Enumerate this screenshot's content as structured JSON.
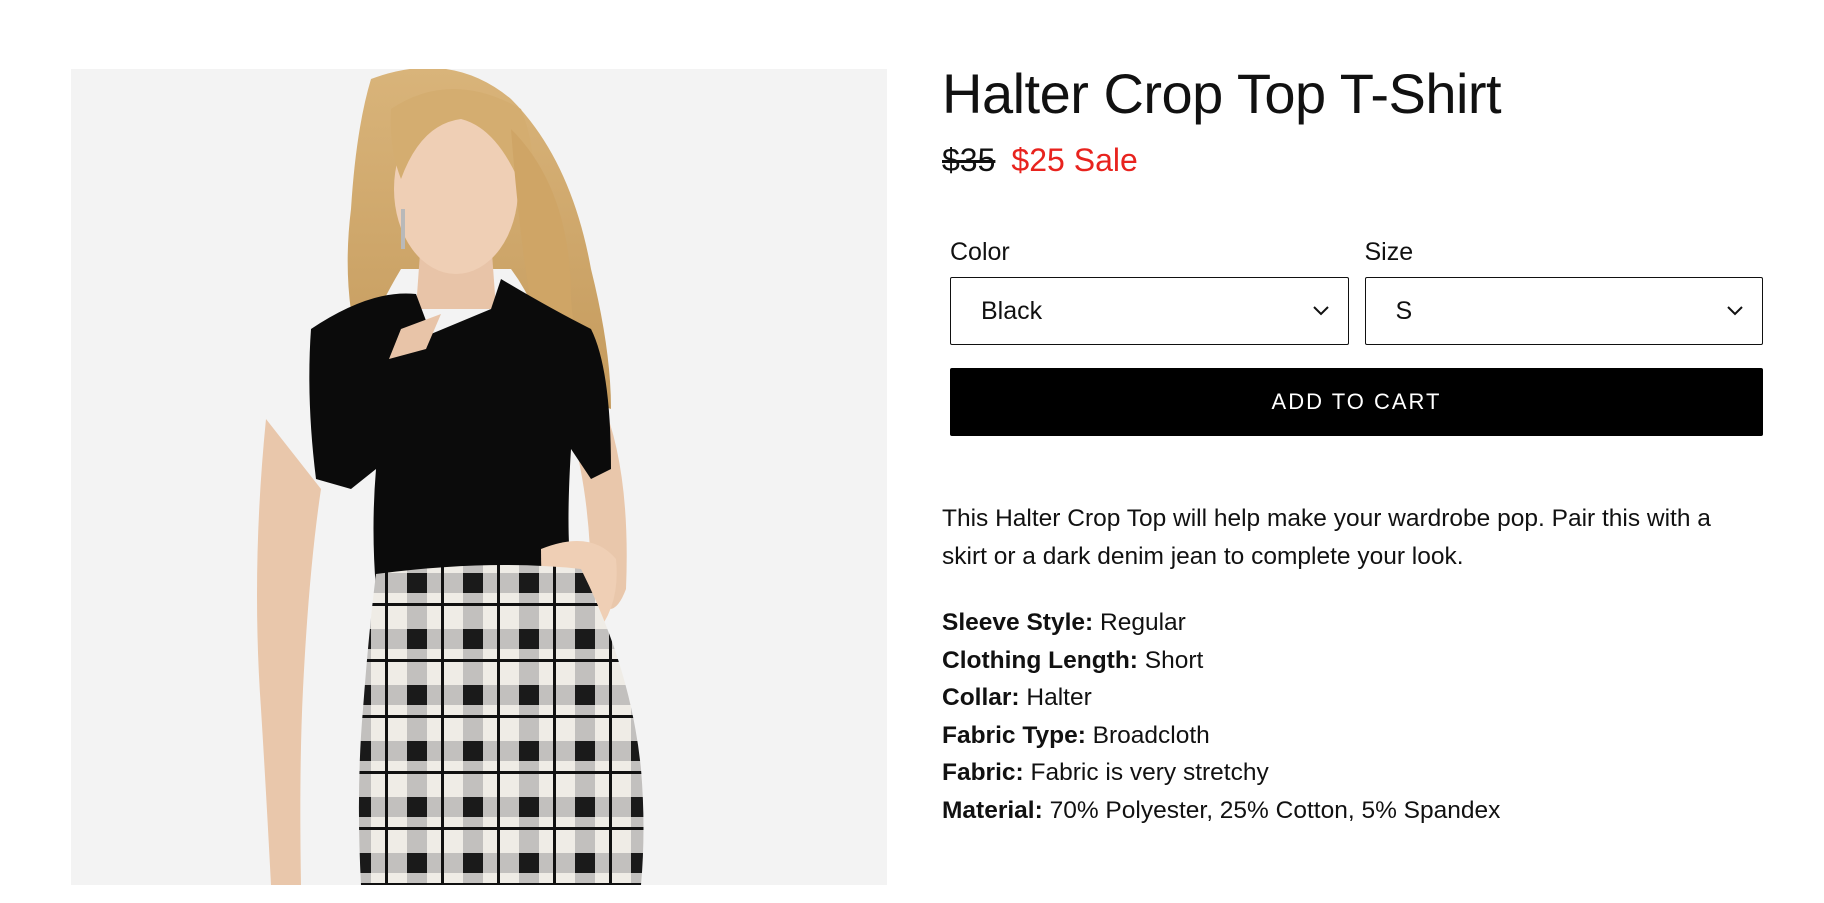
{
  "product": {
    "title": "Halter Crop Top T-Shirt",
    "price_original": "$35",
    "price_sale": "$25",
    "sale_label": "Sale",
    "sale_color": "#e8231e"
  },
  "options": {
    "color": {
      "label": "Color",
      "value": "Black"
    },
    "size": {
      "label": "Size",
      "value": "S"
    }
  },
  "cta": {
    "add_to_cart": "ADD TO CART"
  },
  "description": "This Halter Crop Top will help make your wardrobe pop. Pair this with a skirt or a dark denim jean to complete your look.",
  "specs": [
    {
      "key": "Sleeve Style:",
      "value": "Regular"
    },
    {
      "key": "Clothing Length:",
      "value": "Short"
    },
    {
      "key": "Collar:",
      "value": "Halter"
    },
    {
      "key": "Fabric Type:",
      "value": "Broadcloth"
    },
    {
      "key": "Fabric:",
      "value": "Fabric is very stretchy"
    },
    {
      "key": "Material:",
      "value": "70% Polyester, 25% Cotton, 5% Spandex"
    }
  ],
  "icons": {
    "select_chevron": "chevron-down-icon"
  }
}
